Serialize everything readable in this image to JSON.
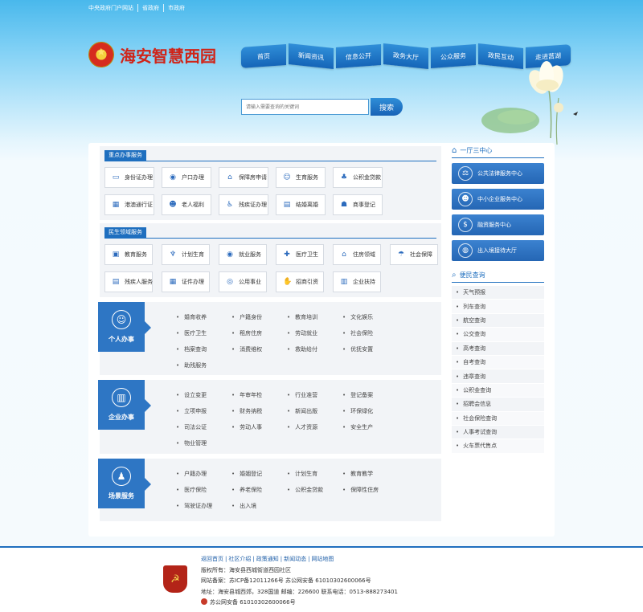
{
  "top_links": [
    "中央政府门户网站",
    "省政府",
    "市政府"
  ],
  "site_title": "海安智慧西园",
  "nav": [
    "首页",
    "新闻资讯",
    "信息公开",
    "政务大厅",
    "公众服务",
    "政民互动",
    "走进莒湖"
  ],
  "search": {
    "placeholder": "请输入需要查询的关键词",
    "button": "搜索"
  },
  "key_services": {
    "title": "重点办事服务",
    "items": [
      {
        "label": "身份证办理",
        "icon": "id-card-icon",
        "glyph": "▭"
      },
      {
        "label": "户口办理",
        "icon": "person-icon",
        "glyph": "◉"
      },
      {
        "label": "保障房申请",
        "icon": "house-icon",
        "glyph": "⌂"
      },
      {
        "label": "生育服务",
        "icon": "family-icon",
        "glyph": "☺"
      },
      {
        "label": "公积金贷款",
        "icon": "tree-icon",
        "glyph": "♣"
      },
      {
        "label": "",
        "icon": "",
        "glyph": ""
      },
      {
        "label": "港澳通行证",
        "icon": "building-icon",
        "glyph": "▦"
      },
      {
        "label": "老人福利",
        "icon": "elderly-icon",
        "glyph": "☻"
      },
      {
        "label": "残疾证办理",
        "icon": "wheelchair-icon",
        "glyph": "♿"
      },
      {
        "label": "结婚离婚",
        "icon": "marriage-icon",
        "glyph": "▤"
      },
      {
        "label": "商事登记",
        "icon": "business-icon",
        "glyph": "☗"
      }
    ]
  },
  "livelihood_services": {
    "title": "民生领域服务",
    "items": [
      {
        "label": "教育服务",
        "icon": "book-icon",
        "glyph": "▣"
      },
      {
        "label": "计划生育",
        "icon": "family-icon",
        "glyph": "♆"
      },
      {
        "label": "就业服务",
        "icon": "worker-icon",
        "glyph": "◉"
      },
      {
        "label": "医疗卫生",
        "icon": "medical-icon",
        "glyph": "✚"
      },
      {
        "label": "住房领域",
        "icon": "house-icon",
        "glyph": "⌂"
      },
      {
        "label": "社会保障",
        "icon": "umbrella-icon",
        "glyph": "☂"
      },
      {
        "label": "残疾人服务",
        "icon": "card-icon",
        "glyph": "▤"
      },
      {
        "label": "证件办理",
        "icon": "certificate-icon",
        "glyph": "▦"
      },
      {
        "label": "公用事业",
        "icon": "utility-icon",
        "glyph": "◎"
      },
      {
        "label": "招商引资",
        "icon": "handshake-icon",
        "glyph": "✋"
      },
      {
        "label": "企业扶持",
        "icon": "chart-icon",
        "glyph": "▥"
      }
    ]
  },
  "categories": [
    {
      "name": "个人办事",
      "icon": "person-icon",
      "glyph": "☺",
      "items": [
        "婚育收养",
        "户籍身份",
        "教育培训",
        "文化娱乐",
        "医疗卫生",
        "租房住房",
        "劳动就业",
        "社会保险",
        "档案查询",
        "消费维权",
        "救助给付",
        "优抚安置",
        "助残服务"
      ]
    },
    {
      "name": "企业办事",
      "icon": "building-icon",
      "glyph": "▥",
      "items": [
        "设立变更",
        "年审年检",
        "行业准营",
        "登记备案",
        "立项申报",
        "财务纳税",
        "新闻出版",
        "环保绿化",
        "司法公证",
        "劳动人事",
        "人才资源",
        "安全生产",
        "物业管理"
      ]
    },
    {
      "name": "场景服务",
      "icon": "scene-icon",
      "glyph": "♟",
      "items": [
        "户籍办理",
        "婚姻登记",
        "计划生育",
        "教育教学",
        "医疗保险",
        "养老保险",
        "公积金贷款",
        "保障性住房",
        "驾驶证办理",
        "出入境"
      ]
    }
  ],
  "one_hall": {
    "title": "一厅三中心",
    "items": [
      {
        "label": "公共法律服务中心",
        "icon": "gavel-icon",
        "glyph": "⚖"
      },
      {
        "label": "中小企业服务中心",
        "icon": "people-icon",
        "glyph": "☻"
      },
      {
        "label": "融资服务中心",
        "icon": "money-bag-icon",
        "glyph": "$"
      },
      {
        "label": "出入境接待大厅",
        "icon": "globe-icon",
        "glyph": "◍"
      }
    ]
  },
  "convenience": {
    "title": "便民查询",
    "items": [
      "天气预报",
      "列车查询",
      "航空查询",
      "公交查询",
      "高考查询",
      "自考查询",
      "违章查询",
      "公积金查询",
      "招聘会信息",
      "社会保险查询",
      "人事考试查询",
      "火车票代售点"
    ]
  },
  "footer": {
    "links": [
      "返回首页",
      "社区介绍",
      "政策通知",
      "新闻动态",
      "网站地图"
    ],
    "copyright": "版权所有：海安县西城街道西园社区",
    "icp": "网站备案：苏ICP备12011266号 苏公网安备 61010302600066号",
    "address": "地址：海安县城西郊，328国道 邮编：226600 联系电话：0513-888273401",
    "police": "苏公网安备 61010302600066号"
  },
  "colors": {
    "primary": "#1f6fbf",
    "emblem_red": "#d02418",
    "sky": "#49b8ec"
  }
}
